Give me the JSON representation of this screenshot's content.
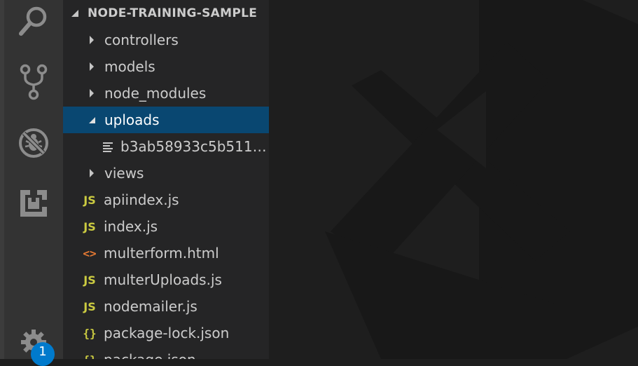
{
  "colors": {
    "activity_bar": "#333333",
    "sidebar": "#252526",
    "editor": "#1e1e1e",
    "selection": "#094771",
    "badge": "#007acc",
    "js_icon": "#cbcb41",
    "html_icon": "#e37933"
  },
  "activity_bar": {
    "icons": [
      "search-icon",
      "source-control-icon",
      "debug-icon",
      "extensions-icon",
      "settings-gear-icon"
    ],
    "badge_count": "1"
  },
  "explorer": {
    "title": "NODE-TRAINING-SAMPLE",
    "items": [
      {
        "label": "controllers",
        "kind": "folder",
        "expanded": false
      },
      {
        "label": "models",
        "kind": "folder",
        "expanded": false
      },
      {
        "label": "node_modules",
        "kind": "folder",
        "expanded": false
      },
      {
        "label": "uploads",
        "kind": "folder",
        "expanded": true,
        "selected": true
      },
      {
        "label": "b3ab58933c5b5115...",
        "kind": "file",
        "icon": "text-file-icon"
      },
      {
        "label": "views",
        "kind": "folder",
        "expanded": false
      },
      {
        "label": "apiindex.js",
        "kind": "file",
        "icon": "js-icon",
        "icon_text": "JS"
      },
      {
        "label": "index.js",
        "kind": "file",
        "icon": "js-icon",
        "icon_text": "JS"
      },
      {
        "label": "multerform.html",
        "kind": "file",
        "icon": "html-icon",
        "icon_text": "<>"
      },
      {
        "label": "multerUploads.js",
        "kind": "file",
        "icon": "js-icon",
        "icon_text": "JS"
      },
      {
        "label": "nodemailer.js",
        "kind": "file",
        "icon": "js-icon",
        "icon_text": "JS"
      },
      {
        "label": "package-lock.json",
        "kind": "file",
        "icon": "json-icon",
        "icon_text": "{}"
      },
      {
        "label": "package.json",
        "kind": "file",
        "icon": "json-icon",
        "icon_text": "{}"
      }
    ]
  },
  "editor": {
    "watermark": "vscode-logo-icon"
  }
}
